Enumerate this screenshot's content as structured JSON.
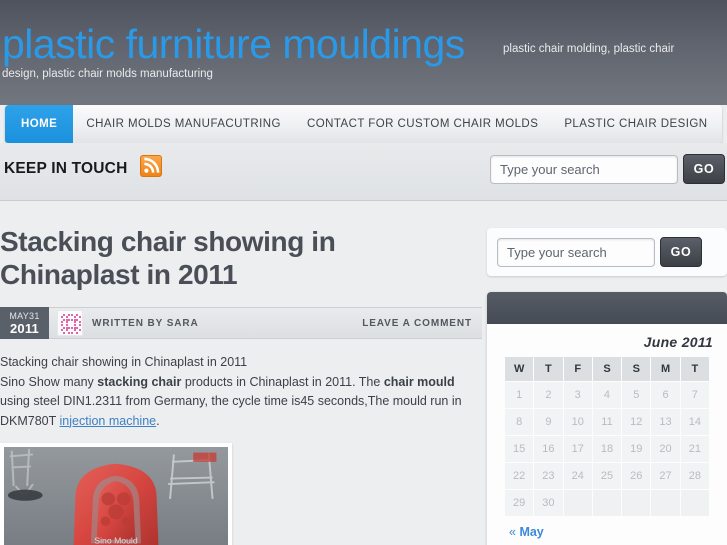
{
  "header": {
    "site_title": "plastic furniture mouldings",
    "tagline_line1": "plastic chair molding, plastic chair",
    "tagline_line2": "design, plastic chair molds manufacturing",
    "title_color": "#2a9ae8"
  },
  "nav": {
    "items": [
      {
        "label": "HOME",
        "active": true
      },
      {
        "label": "CHAIR MOLDS MANUFACUTRING",
        "active": false
      },
      {
        "label": "CONTACT FOR CUSTOM CHAIR MOLDS",
        "active": false
      },
      {
        "label": "PLASTIC CHAIR DESIGN",
        "active": false
      }
    ],
    "active_color": "#1b91de"
  },
  "touch_strip": {
    "label": "KEEP IN TOUCH",
    "rss_icon": "rss-icon",
    "rss_color": "#ef8316"
  },
  "search": {
    "placeholder": "Type your search",
    "value": "",
    "go_label": "GO"
  },
  "sidebar_search": {
    "placeholder": "Type your search",
    "value": "",
    "go_label": "GO"
  },
  "post": {
    "title": "Stacking chair showing in Chinaplast in 2011",
    "date_month": "MAY31",
    "date_year": "2011",
    "author_label": "WRITTEN BY SARA",
    "comment_label": "LEAVE A COMMENT",
    "body_line1": "Stacking chair showing in Chinaplast in 2011",
    "body_p2_a": "Sino Show many ",
    "body_p2_b": "stacking chair",
    "body_p2_c": " products in Chinaplast in 2011. The ",
    "body_p2_d": "chair mould",
    "body_p2_e": " using steel DIN1.2311 from Germany, the cycle time is45 seconds,The mould run in DKM780T ",
    "body_link": "injection machine",
    "body_p2_f": ".",
    "photo_alt": "red stacking chair photo"
  },
  "calendar": {
    "caption": "June 2011",
    "weekdays": [
      "W",
      "T",
      "F",
      "S",
      "S",
      "M",
      "T"
    ],
    "weeks": [
      [
        "1",
        "2",
        "3",
        "4",
        "5",
        "6",
        "7"
      ],
      [
        "8",
        "9",
        "10",
        "11",
        "12",
        "13",
        "14"
      ],
      [
        "15",
        "16",
        "17",
        "18",
        "19",
        "20",
        "21"
      ],
      [
        "22",
        "23",
        "24",
        "25",
        "26",
        "27",
        "28"
      ],
      [
        "29",
        "30",
        "",
        "",
        "",
        "",
        ""
      ]
    ],
    "prev_chevron": "«",
    "prev_label": "May"
  }
}
